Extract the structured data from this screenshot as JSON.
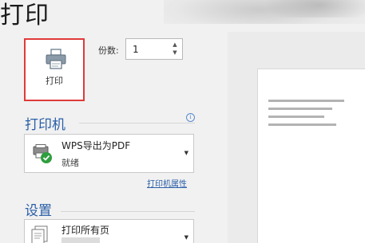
{
  "header": {
    "title": "打印"
  },
  "print_button": {
    "label": "打印",
    "icon": "printer-icon"
  },
  "copies": {
    "label": "份数:",
    "value": "1"
  },
  "printer_section": {
    "title": "打印机",
    "selected_printer": "WPS导出为PDF",
    "status": "就绪",
    "properties_link": "打印机属性",
    "status_color": "#2e9e3e"
  },
  "settings_section": {
    "title": "设置",
    "range": "打印所有页"
  },
  "colors": {
    "accent": "#2a5fa8",
    "highlight_border": "#e03a3a"
  }
}
